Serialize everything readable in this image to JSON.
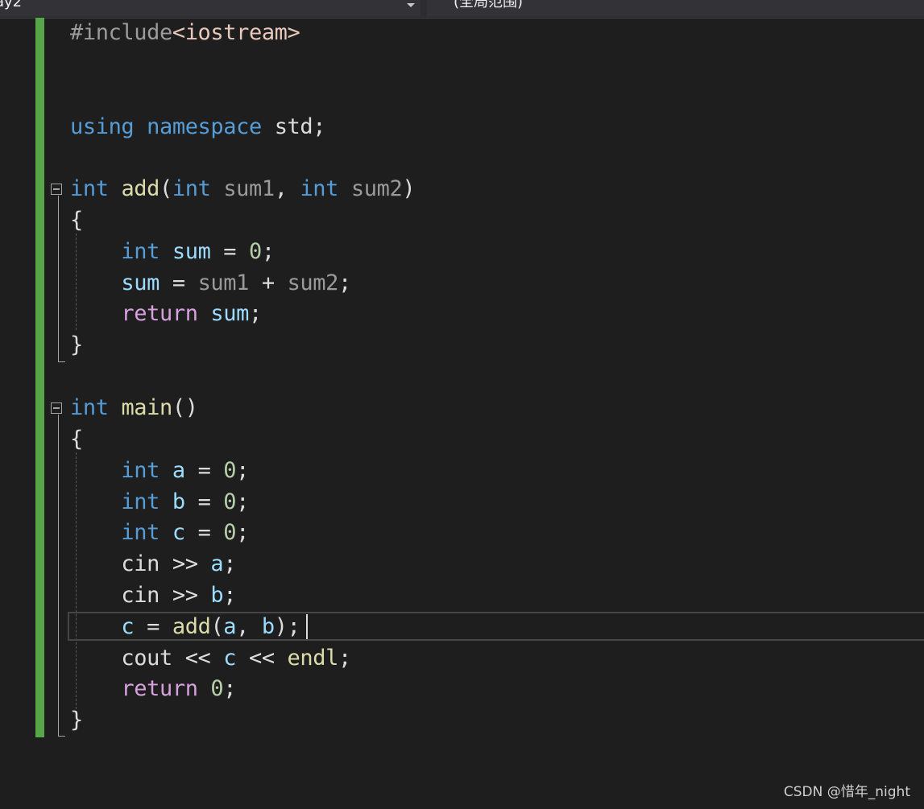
{
  "navigation_bar": {
    "project_dropdown": {
      "value": "ay2"
    },
    "scope_dropdown": {
      "value": "(全局范围)"
    }
  },
  "editor": {
    "language": "C++",
    "lines": [
      {
        "tokens": [
          {
            "text": "#include",
            "type": "preproc"
          },
          {
            "text": "<iostream>",
            "type": "string"
          }
        ]
      },
      {
        "tokens": []
      },
      {
        "tokens": []
      },
      {
        "tokens": [
          {
            "text": "using",
            "type": "keyword"
          },
          {
            "text": " ",
            "type": "plain"
          },
          {
            "text": "namespace",
            "type": "keyword"
          },
          {
            "text": " std;",
            "type": "plain"
          }
        ]
      },
      {
        "tokens": []
      },
      {
        "tokens": [
          {
            "text": "int",
            "type": "keyword"
          },
          {
            "text": " ",
            "type": "plain"
          },
          {
            "text": "add",
            "type": "function"
          },
          {
            "text": "(",
            "type": "plain"
          },
          {
            "text": "int",
            "type": "keyword"
          },
          {
            "text": " ",
            "type": "plain"
          },
          {
            "text": "sum1",
            "type": "param"
          },
          {
            "text": ", ",
            "type": "plain"
          },
          {
            "text": "int",
            "type": "keyword"
          },
          {
            "text": " ",
            "type": "plain"
          },
          {
            "text": "sum2",
            "type": "param"
          },
          {
            "text": ")",
            "type": "plain"
          }
        ]
      },
      {
        "tokens": [
          {
            "text": "{",
            "type": "plain"
          }
        ]
      },
      {
        "tokens": [
          {
            "text": "    ",
            "type": "plain"
          },
          {
            "text": "int",
            "type": "keyword"
          },
          {
            "text": " ",
            "type": "plain"
          },
          {
            "text": "sum",
            "type": "local"
          },
          {
            "text": " = ",
            "type": "plain"
          },
          {
            "text": "0",
            "type": "number"
          },
          {
            "text": ";",
            "type": "plain"
          }
        ]
      },
      {
        "tokens": [
          {
            "text": "    ",
            "type": "plain"
          },
          {
            "text": "sum",
            "type": "local"
          },
          {
            "text": " = ",
            "type": "plain"
          },
          {
            "text": "sum1",
            "type": "param"
          },
          {
            "text": " + ",
            "type": "plain"
          },
          {
            "text": "sum2",
            "type": "param"
          },
          {
            "text": ";",
            "type": "plain"
          }
        ]
      },
      {
        "tokens": [
          {
            "text": "    ",
            "type": "plain"
          },
          {
            "text": "return",
            "type": "control"
          },
          {
            "text": " ",
            "type": "plain"
          },
          {
            "text": "sum",
            "type": "local"
          },
          {
            "text": ";",
            "type": "plain"
          }
        ]
      },
      {
        "tokens": [
          {
            "text": "}",
            "type": "plain"
          }
        ]
      },
      {
        "tokens": []
      },
      {
        "tokens": [
          {
            "text": "int",
            "type": "keyword"
          },
          {
            "text": " ",
            "type": "plain"
          },
          {
            "text": "main",
            "type": "function"
          },
          {
            "text": "()",
            "type": "plain"
          }
        ]
      },
      {
        "tokens": [
          {
            "text": "{",
            "type": "plain"
          }
        ]
      },
      {
        "tokens": [
          {
            "text": "    ",
            "type": "plain"
          },
          {
            "text": "int",
            "type": "keyword"
          },
          {
            "text": " ",
            "type": "plain"
          },
          {
            "text": "a",
            "type": "local"
          },
          {
            "text": " = ",
            "type": "plain"
          },
          {
            "text": "0",
            "type": "number"
          },
          {
            "text": ";",
            "type": "plain"
          }
        ]
      },
      {
        "tokens": [
          {
            "text": "    ",
            "type": "plain"
          },
          {
            "text": "int",
            "type": "keyword"
          },
          {
            "text": " ",
            "type": "plain"
          },
          {
            "text": "b",
            "type": "local"
          },
          {
            "text": " = ",
            "type": "plain"
          },
          {
            "text": "0",
            "type": "number"
          },
          {
            "text": ";",
            "type": "plain"
          }
        ]
      },
      {
        "tokens": [
          {
            "text": "    ",
            "type": "plain"
          },
          {
            "text": "int",
            "type": "keyword"
          },
          {
            "text": " ",
            "type": "plain"
          },
          {
            "text": "c",
            "type": "local"
          },
          {
            "text": " = ",
            "type": "plain"
          },
          {
            "text": "0",
            "type": "number"
          },
          {
            "text": ";",
            "type": "plain"
          }
        ]
      },
      {
        "tokens": [
          {
            "text": "    cin >> ",
            "type": "plain"
          },
          {
            "text": "a",
            "type": "local"
          },
          {
            "text": ";",
            "type": "plain"
          }
        ]
      },
      {
        "tokens": [
          {
            "text": "    cin >> ",
            "type": "plain"
          },
          {
            "text": "b",
            "type": "local"
          },
          {
            "text": ";",
            "type": "plain"
          }
        ]
      },
      {
        "tokens": [
          {
            "text": "    ",
            "type": "plain"
          },
          {
            "text": "c",
            "type": "local"
          },
          {
            "text": " = ",
            "type": "plain"
          },
          {
            "text": "add",
            "type": "function"
          },
          {
            "text": "(",
            "type": "plain"
          },
          {
            "text": "a",
            "type": "local"
          },
          {
            "text": ", ",
            "type": "plain"
          },
          {
            "text": "b",
            "type": "local"
          },
          {
            "text": ");",
            "type": "plain"
          }
        ]
      },
      {
        "tokens": [
          {
            "text": "    cout << ",
            "type": "plain"
          },
          {
            "text": "c",
            "type": "local"
          },
          {
            "text": " << ",
            "type": "plain"
          },
          {
            "text": "endl",
            "type": "function"
          },
          {
            "text": ";",
            "type": "plain"
          }
        ]
      },
      {
        "tokens": [
          {
            "text": "    ",
            "type": "plain"
          },
          {
            "text": "return",
            "type": "control"
          },
          {
            "text": " ",
            "type": "plain"
          },
          {
            "text": "0",
            "type": "number"
          },
          {
            "text": ";",
            "type": "plain"
          }
        ]
      },
      {
        "tokens": [
          {
            "text": "}",
            "type": "plain"
          }
        ]
      }
    ]
  },
  "watermark": {
    "text": "CSDN @惜年_night"
  },
  "colors": {
    "background": "#1e1e1e",
    "change_bar": "#57a64a",
    "keyword": "#569cd6",
    "control": "#d8a0df",
    "function": "#dcdcaa",
    "local": "#9cdcfe",
    "param": "#9a9a9a",
    "number": "#b5cea8",
    "string": "#e8c9bb",
    "plain": "#dcdcdc"
  }
}
